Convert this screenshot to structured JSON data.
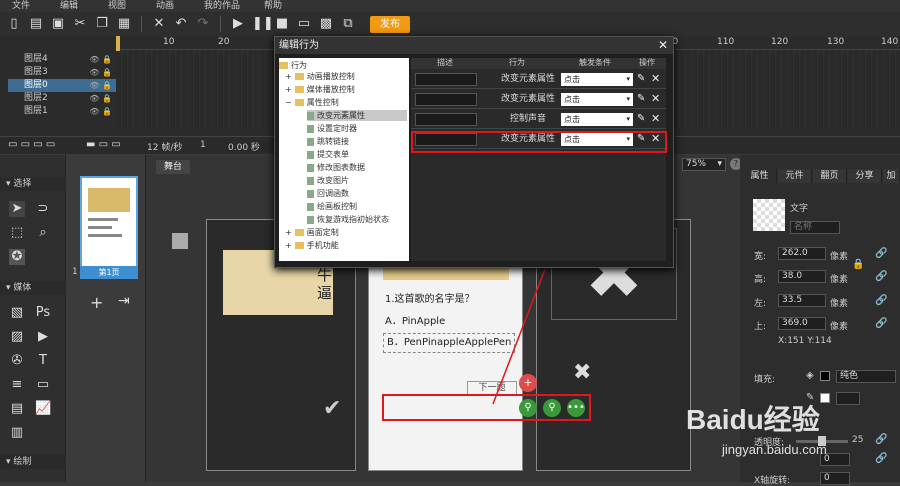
{
  "menu": [
    "文件",
    "编辑",
    "视图",
    "动画",
    "我的作品",
    "帮助"
  ],
  "toolbar": {
    "publish_label": "发布"
  },
  "timeline": {
    "ruler": [
      "10",
      "20",
      "30",
      "40",
      "50",
      "60",
      "70",
      "80",
      "90",
      "100",
      "110",
      "120",
      "130",
      "140"
    ],
    "layers": [
      {
        "name": "图层4"
      },
      {
        "name": "图层3"
      },
      {
        "name": "图层0"
      },
      {
        "name": "图层2"
      },
      {
        "name": "图层1"
      }
    ],
    "fps": "12 帧/秒",
    "frame": "1",
    "time": "0.00 秒"
  },
  "left": {
    "select_section": "选择",
    "media_section": "媒体",
    "draw_section": "绘制"
  },
  "pages": {
    "page_label": "第1页",
    "page_number": "1"
  },
  "stage": {
    "tab": "舞台",
    "zoom": "75%",
    "question": "1.这首歌的名字是？",
    "option_a": "A．PinApple",
    "option_b": "B．PenPinappleApplePen",
    "next_btn": "下一题",
    "side_text": "牛\n逼"
  },
  "right": {
    "tabs": [
      "属性",
      "元件",
      "翻页",
      "分享",
      "加"
    ],
    "name_label": "文字",
    "name_placeholder": "名称",
    "width_label": "宽:",
    "width_value": "262.0",
    "height_label": "高:",
    "height_value": "38.0",
    "left_label": "左:",
    "left_value": "33.5",
    "top_label": "上:",
    "top_value": "369.0",
    "unit": "像素",
    "coords": "X:151    Y:114",
    "fill_label": "填充:",
    "fill_type": "纯色",
    "alpha_label": "透明度:",
    "alpha_value": "25",
    "zero1": "0",
    "zero2": "0",
    "xrot_label": "X轴旋转:"
  },
  "dialog": {
    "title": "编辑行为",
    "tree_root": "行为",
    "tree": [
      {
        "label": "动画播放控制",
        "type": "folder",
        "indent": 0
      },
      {
        "label": "媒体播放控制",
        "type": "folder",
        "indent": 0
      },
      {
        "label": "属性控制",
        "type": "folder",
        "indent": 0
      },
      {
        "label": "改变元素属性",
        "type": "item",
        "indent": 1
      },
      {
        "label": "设置定时器",
        "type": "item",
        "indent": 1
      },
      {
        "label": "跳转链接",
        "type": "item",
        "indent": 1
      },
      {
        "label": "提交表单",
        "type": "item",
        "indent": 1
      },
      {
        "label": "修改图表数据",
        "type": "item",
        "indent": 1
      },
      {
        "label": "改变图片",
        "type": "item",
        "indent": 1
      },
      {
        "label": "回调函数",
        "type": "item",
        "indent": 1
      },
      {
        "label": "绘画板控制",
        "type": "item",
        "indent": 1
      },
      {
        "label": "恢复游戏指初始状态",
        "type": "item",
        "indent": 1
      },
      {
        "label": "画面定制",
        "type": "folder",
        "indent": 0
      },
      {
        "label": "手机功能",
        "type": "folder",
        "indent": 0
      }
    ],
    "cols": {
      "desc": "描述",
      "action": "行为",
      "trigger": "触发条件",
      "op": "操作"
    },
    "rows": [
      {
        "action": "改变元素属性",
        "trigger": "点击"
      },
      {
        "action": "改变元素属性",
        "trigger": "点击"
      },
      {
        "action": "控制声音",
        "trigger": "点击"
      },
      {
        "action": "改变元素属性",
        "trigger": "点击"
      }
    ]
  },
  "watermark": {
    "brand": "Baidu经验",
    "url": "jingyan.baidu.com"
  }
}
